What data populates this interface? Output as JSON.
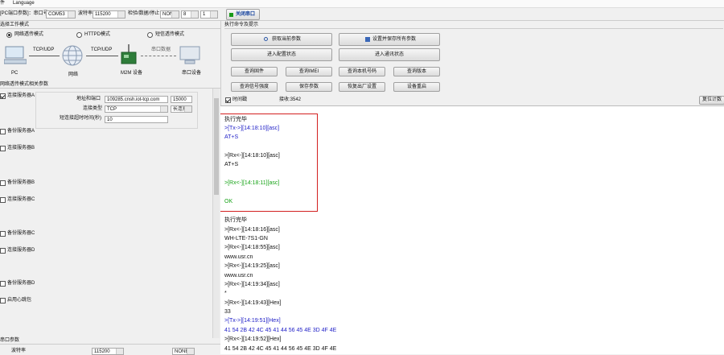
{
  "menu": {
    "items": [
      "文件",
      "Language"
    ]
  },
  "toolbar": {
    "port_label": "[PC端口参数]：串口号",
    "port_value": "COM53",
    "baud_label": "波特率",
    "baud_value": "115200",
    "parity_label": "检验/数据/停止",
    "parity_value": "NONE",
    "data_bits": "8",
    "stop_bits": "1",
    "close_port_label": "关闭串口"
  },
  "left": {
    "work_mode_title": "选择工作模式",
    "modes": [
      {
        "label": "网络透传模式",
        "selected": true
      },
      {
        "label": "HTTPD模式",
        "selected": false
      },
      {
        "label": "短信透传模式",
        "selected": false
      }
    ],
    "diagram": {
      "tcp1": "TCP/UDP",
      "tcp2": "TCP/UDP",
      "sms": "串口数据",
      "pc": "PC",
      "net": "网络",
      "m2m": "M2M 设备",
      "serial_dev": "串口设备"
    },
    "params_title": "网络透传模式相关参数",
    "serverA": {
      "label": "连接服务器A",
      "checked": true,
      "addr_label": "地址和端口",
      "addr_value": "109285.cnsh.iot-tcp.com",
      "port_value": "15000",
      "type_label": "连接类型",
      "type_value": "TCP",
      "conn_value": "长连接",
      "timeout_label": "短连接超时时间(秒)",
      "timeout_value": "10"
    },
    "servers": [
      {
        "label": "备份服务器A",
        "checked": false
      },
      {
        "label": "连接服务器B",
        "checked": false
      },
      {
        "label": "备份服务器B",
        "checked": false
      },
      {
        "label": "连接服务器C",
        "checked": false
      },
      {
        "label": "备份服务器C",
        "checked": false
      },
      {
        "label": "连接服务器D",
        "checked": false
      },
      {
        "label": "备份服务器D",
        "checked": false
      },
      {
        "label": "启用心跳包",
        "checked": false
      }
    ],
    "bottom_title": "串口参数",
    "bottom_label": "波特率",
    "bottom_value": "115200",
    "bottom_parity": "NONE"
  },
  "right": {
    "title": "执行命令及提示",
    "buttons": {
      "get_params": "获取当前参数",
      "save_all": "设置并保存所有参数",
      "enter_config": "进入配置状态",
      "enter_comm": "进入通讯状态",
      "firmware": "查询固件",
      "imei": "查询IMEI",
      "local_num": "查询本机号码",
      "query_ver": "查询版本",
      "query_sig": "查询信号强度",
      "save_param": "保存参数",
      "factory": "恢复出厂设置",
      "restart": "设备重启"
    },
    "timestamp_label": "时间戳",
    "timestamp_checked": true,
    "recv_label": "接收:3542",
    "reset_count": "复位计数"
  },
  "terminal": {
    "lines": [
      {
        "text": "执行完毕",
        "color": "#111111"
      },
      {
        "text": ">[Tx->][14:18:10][asc]",
        "color": "#2323c8"
      },
      {
        "text": "AT+S",
        "color": "#2323c8"
      },
      {
        "text": "",
        "color": "#111111"
      },
      {
        "text": ">[Rx<-][14:18:10][asc]",
        "color": "#111111"
      },
      {
        "text": "AT+S",
        "color": "#111111"
      },
      {
        "text": "",
        "color": "#111111"
      },
      {
        "text": ">[Rx<-][14:18:11][asc]",
        "color": "#17a317"
      },
      {
        "text": "",
        "color": "#111111"
      },
      {
        "text": "OK",
        "color": "#17a317"
      },
      {
        "text": "",
        "color": "#111111"
      },
      {
        "text": "执行完毕",
        "color": "#111111"
      },
      {
        "text": ">[Rx<-][14:18:16][asc]",
        "color": "#111111"
      },
      {
        "text": "WH-LTE-7S1-GN",
        "color": "#111111"
      },
      {
        "text": ">[Rx<-][14:18:55][asc]",
        "color": "#111111"
      },
      {
        "text": "www.usr.cn",
        "color": "#111111"
      },
      {
        "text": ">[Rx<-][14:19:25][asc]",
        "color": "#111111"
      },
      {
        "text": "www.usr.cn",
        "color": "#111111"
      },
      {
        "text": ">[Rx<-][14:19:34][asc]",
        "color": "#111111"
      },
      {
        "text": "*",
        "color": "#111111"
      },
      {
        "text": ">[Rx<-][14:19:43][Hex]",
        "color": "#111111"
      },
      {
        "text": "33",
        "color": "#111111"
      },
      {
        "text": ">[Tx->][14:19:51][Hex]",
        "color": "#2323c8"
      },
      {
        "text": "41 54 2B 42 4C 45 41 44 56 45 4E 3D 4F 4E",
        "color": "#2323c8"
      },
      {
        "text": ">[Rx<-][14:19:52][Hex]",
        "color": "#111111"
      },
      {
        "text": "41 54 2B 42 4C 45 41 44 56 45 4E 3D 4F 4E",
        "color": "#111111"
      }
    ]
  },
  "colors": {
    "highlight_box": "#d32020",
    "tx_blue": "#2323c8",
    "ok_green": "#17a317"
  }
}
